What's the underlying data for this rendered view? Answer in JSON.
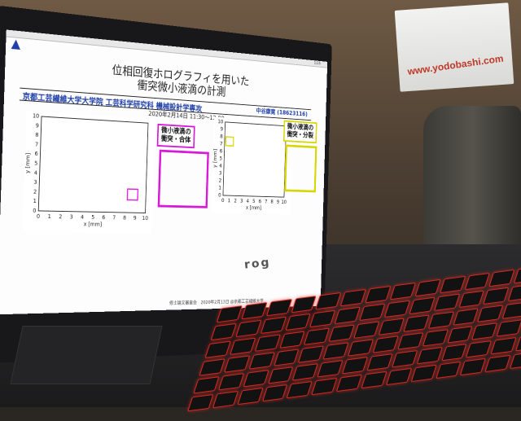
{
  "slide": {
    "page": "1/15",
    "title_line1": "位相回復ホログラフィを用いた",
    "title_line2": "衝突微小液滴の計測",
    "affiliation": "京都工芸繊維大学大学院 工芸科学研究科 機械設計学専攻",
    "author": "中谷康寛 (18623116)",
    "datetime": "2020年2月14日 11:30～12:00",
    "footer": "修士論文審査会　2020年2月13日 @京都工芸繊維大学",
    "label_merge": "微小液滴の\n衝突・合体",
    "label_split": "微小液滴の\n衝突・分裂",
    "colors": {
      "affil_blue": "#1f3fa8",
      "magenta": "#d81ad8",
      "yellow": "#d6d600"
    }
  },
  "box_text": "www.yodobashi.com",
  "laptop_brand": "rog",
  "chart_data": [
    {
      "type": "scatter",
      "xlabel": "x [mm]",
      "ylabel": "y [mm]",
      "xlim": [
        0,
        10
      ],
      "ylim": [
        0,
        10
      ],
      "x_ticks": [
        "0",
        "1",
        "2",
        "3",
        "4",
        "5",
        "6",
        "7",
        "8",
        "9",
        "10"
      ],
      "y_ticks": [
        "0",
        "1",
        "2",
        "3",
        "4",
        "5",
        "6",
        "7",
        "8",
        "9",
        "10"
      ]
    },
    {
      "type": "scatter",
      "xlabel": "x [mm]",
      "ylabel": "y [mm]",
      "xlim": [
        0,
        10
      ],
      "ylim": [
        0,
        10
      ],
      "x_ticks": [
        "0",
        "1",
        "2",
        "3",
        "4",
        "5",
        "6",
        "7",
        "8",
        "9",
        "10"
      ],
      "y_ticks": [
        "0",
        "1",
        "2",
        "3",
        "4",
        "5",
        "6",
        "7",
        "8",
        "9",
        "10"
      ]
    }
  ]
}
